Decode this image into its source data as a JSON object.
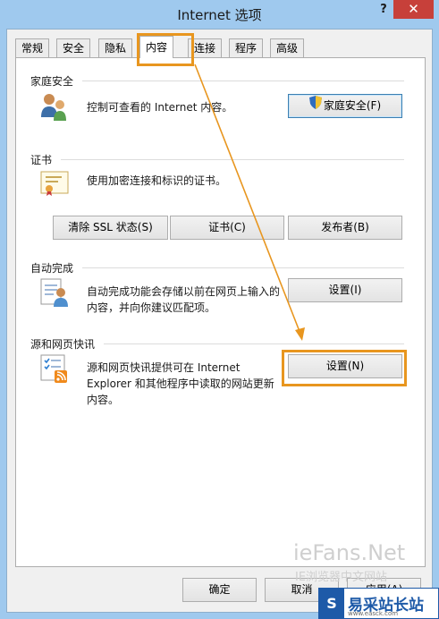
{
  "window": {
    "title": "Internet 选项",
    "help_glyph": "?",
    "close_glyph": "✕"
  },
  "tabs": [
    {
      "label": "常规"
    },
    {
      "label": "安全"
    },
    {
      "label": "隐私"
    },
    {
      "label": "内容"
    },
    {
      "label": "连接"
    },
    {
      "label": "程序"
    },
    {
      "label": "高级"
    }
  ],
  "family_safety": {
    "title": "家庭安全",
    "description": "控制可查看的 Internet 内容。",
    "button": "家庭安全(F)"
  },
  "certificates": {
    "title": "证书",
    "description": "使用加密连接和标识的证书。",
    "btn_clear_ssl": "清除 SSL 状态(S)",
    "btn_certificates": "证书(C)",
    "btn_publishers": "发布者(B)"
  },
  "autocomplete": {
    "title": "自动完成",
    "description_line1": "自动完成功能会存储以前在网页上输入的",
    "description_line2": "内容，并向你建议匹配项。",
    "button": "设置(I)"
  },
  "feeds": {
    "title": "源和网页快讯",
    "description_line1": "源和网页快讯提供可在 Internet",
    "description_line2": "Explorer 和其他程序中读取的网站更新",
    "description_line3": "内容。",
    "button": "设置(N)"
  },
  "footer": {
    "ok": "确定",
    "cancel": "取消",
    "apply": "应用(A)"
  },
  "watermark": {
    "site": "ieFans.Net",
    "subtitle": "IE浏览器中文网站"
  },
  "logo": {
    "mark": "S",
    "text": "易采站长站",
    "url": "www.easck.com"
  },
  "colors": {
    "highlight": "#e8961f",
    "title_bar": "#9fc9ee",
    "close_button": "#c7403a"
  }
}
